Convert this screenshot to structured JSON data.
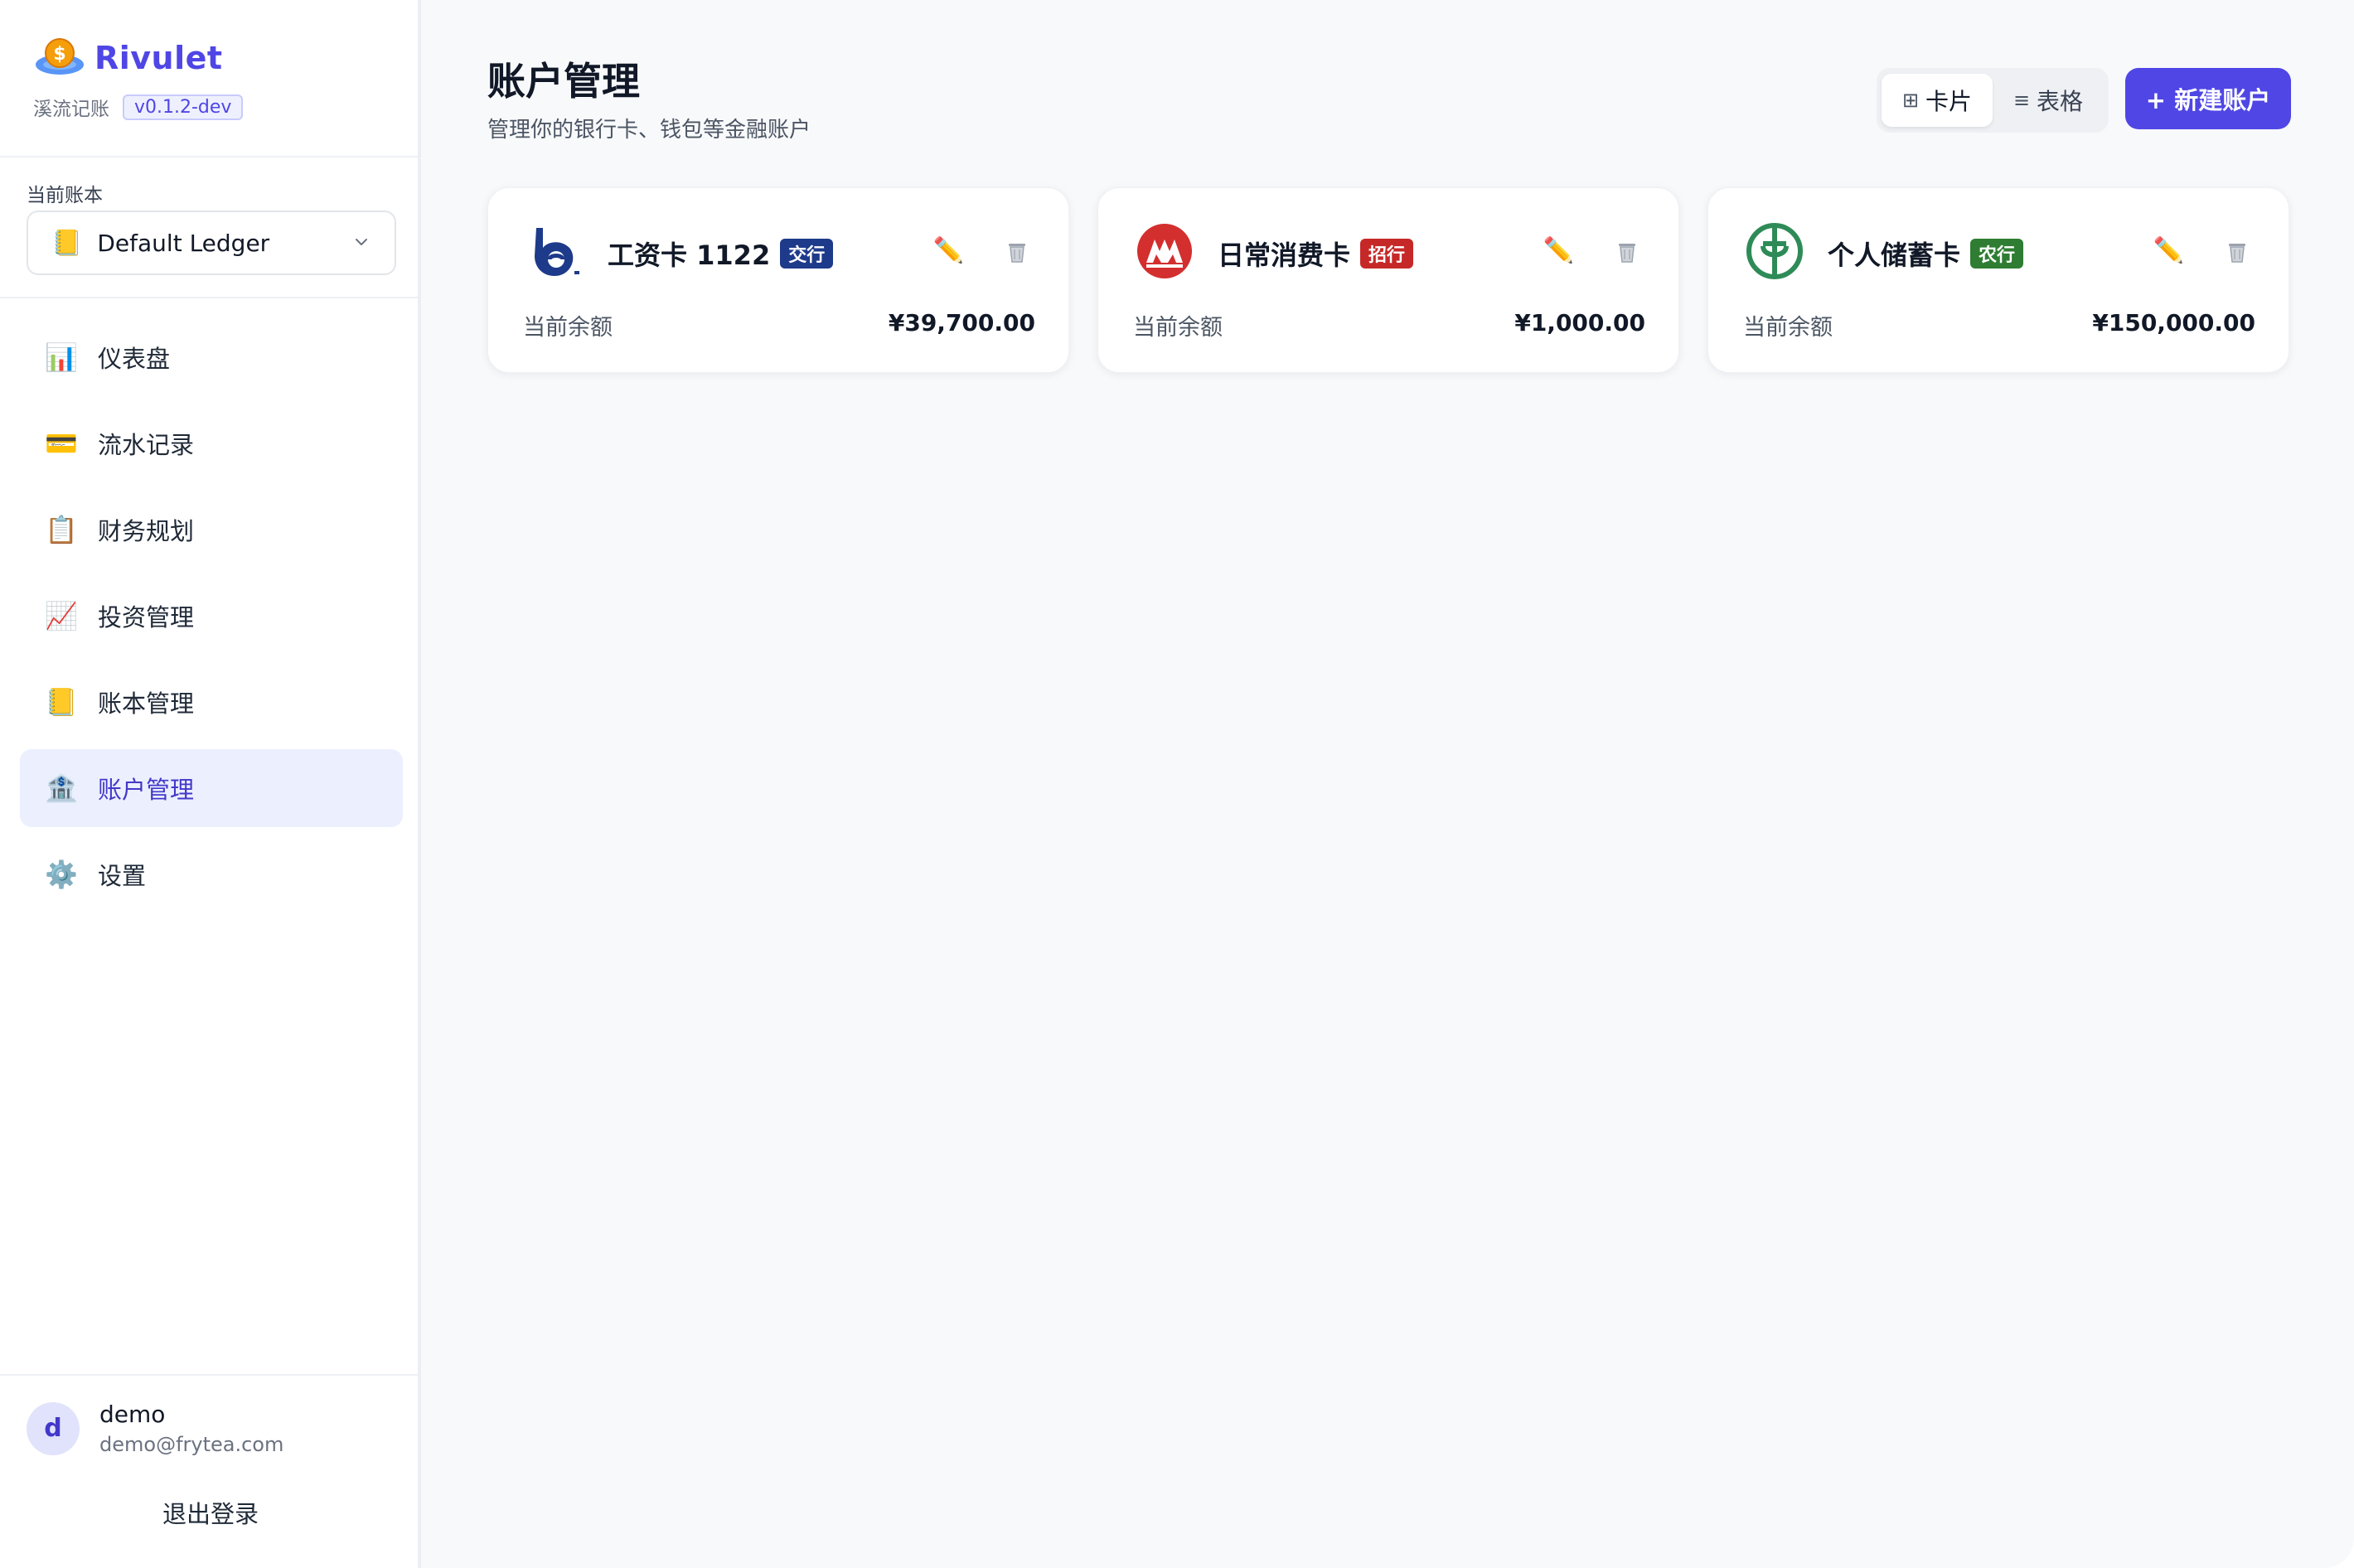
{
  "brand": {
    "name": "Rivulet",
    "subtitle": "溪流记账",
    "version": "v0.1.2-dev",
    "logo_icon": "coin-globe-icon"
  },
  "ledger": {
    "label": "当前账本",
    "selected": "Default Ledger",
    "icon": "ledger-icon"
  },
  "nav": {
    "items": [
      {
        "label": "仪表盘",
        "icon": "bar-chart-icon"
      },
      {
        "label": "流水记录",
        "icon": "credit-card-icon"
      },
      {
        "label": "财务规划",
        "icon": "clipboard-icon"
      },
      {
        "label": "投资管理",
        "icon": "trend-up-icon"
      },
      {
        "label": "账本管理",
        "icon": "ledger-icon"
      },
      {
        "label": "账户管理",
        "icon": "bank-icon",
        "active": true
      },
      {
        "label": "设置",
        "icon": "gear-icon"
      }
    ]
  },
  "user": {
    "initial": "d",
    "name": "demo",
    "email": "demo@frytea.com",
    "logout_label": "退出登录"
  },
  "page": {
    "title": "账户管理",
    "subtitle": "管理你的银行卡、钱包等金融账户"
  },
  "toolbar": {
    "view_card_label": "卡片",
    "view_table_label": "表格",
    "active_view": "card",
    "new_account_label": "+ 新建账户"
  },
  "accounts": [
    {
      "name": "工资卡 1122",
      "bank": "交行",
      "bank_color": "#1e3a8a",
      "balance_label": "当前余额",
      "balance": "¥39,700.00",
      "logo": "bocom-logo-icon"
    },
    {
      "name": "日常消费卡",
      "bank": "招行",
      "bank_color": "#c62828",
      "balance_label": "当前余额",
      "balance": "¥1,000.00",
      "logo": "cmb-logo-icon"
    },
    {
      "name": "个人储蓄卡",
      "bank": "农行",
      "bank_color": "#2e7d32",
      "balance_label": "当前余额",
      "balance": "¥150,000.00",
      "logo": "abc-logo-icon"
    }
  ],
  "colors": {
    "accent": "#4f46e5",
    "active_nav_bg": "#eceffe",
    "main_bg": "#f8f9fb"
  }
}
